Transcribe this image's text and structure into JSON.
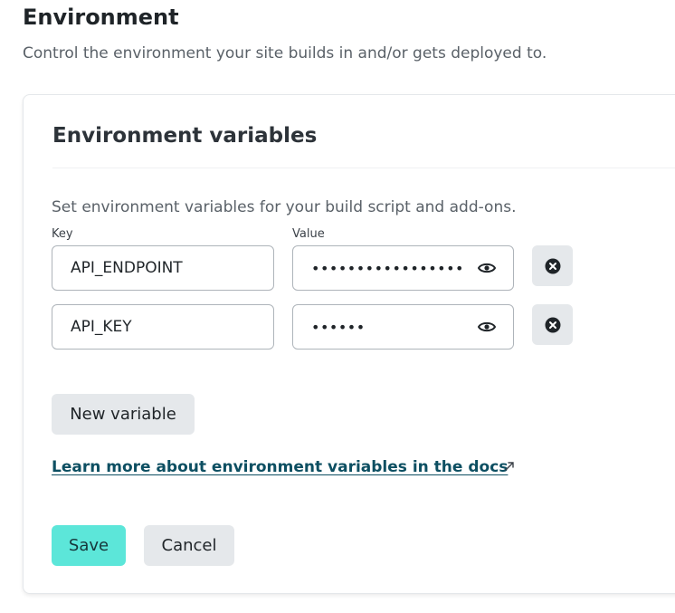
{
  "section": {
    "title": "Environment",
    "description": "Control the environment your site builds in and/or gets deployed to."
  },
  "card": {
    "title": "Environment variables",
    "help_text": "Set environment variables for your build script and add-ons.",
    "key_label": "Key",
    "value_label": "Value"
  },
  "variables": [
    {
      "key": "API_ENDPOINT",
      "value_masked": "••••••••••••••••••••••"
    },
    {
      "key": "API_KEY",
      "value_masked": "••••••"
    }
  ],
  "actions": {
    "new_variable": "New variable",
    "docs_link": "Learn more about environment variables in the docs",
    "save": "Save",
    "cancel": "Cancel"
  },
  "icons": {
    "show_value": "eye-icon",
    "remove_variable": "close-circle-icon",
    "external_link": "external-link-icon"
  },
  "colors": {
    "primary_button": "#5ce6d9",
    "link": "#0d4f62",
    "secondary_button": "#e5e8eb"
  }
}
